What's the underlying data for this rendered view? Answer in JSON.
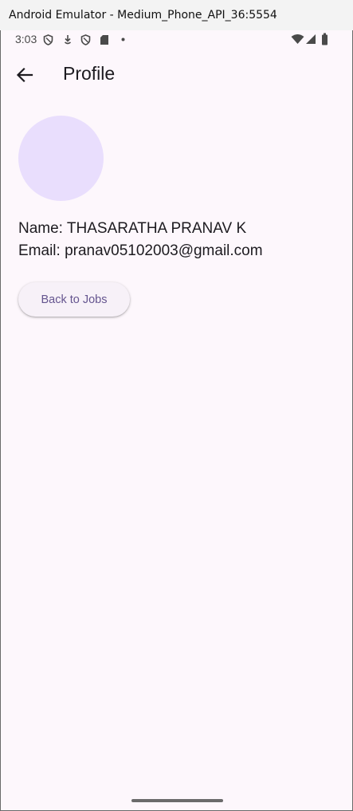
{
  "window": {
    "title": "Android Emulator - Medium_Phone_API_36:5554"
  },
  "status_bar": {
    "time": "3:03",
    "left_icons": [
      "shield-icon",
      "download-icon",
      "shield-icon",
      "sd-card-icon",
      "dot-icon"
    ],
    "right_icons": [
      "wifi-icon",
      "signal-icon",
      "battery-icon"
    ]
  },
  "app_bar": {
    "title": "Profile",
    "back_icon": "arrow-left-icon"
  },
  "profile": {
    "avatar_color": "#e9defd",
    "name_line": "Name: THASARATHA PRANAV K",
    "email_line": "Email: pranav05102003@gmail.com"
  },
  "actions": {
    "back_to_jobs_label": "Back to Jobs"
  },
  "colors": {
    "background": "#fdf7fc",
    "accent": "#65558f"
  }
}
